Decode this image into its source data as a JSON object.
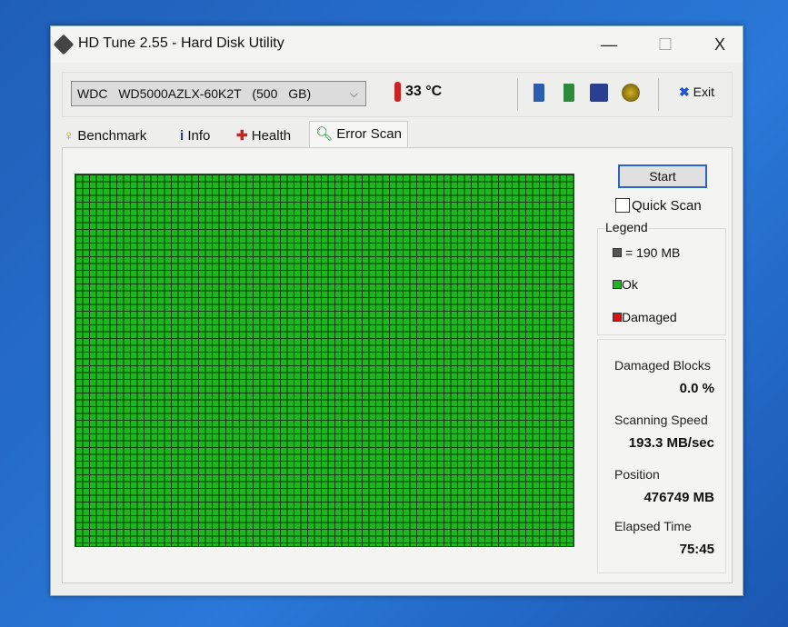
{
  "window": {
    "title": "HD Tune 2.55 - Hard Disk Utility",
    "minimize": "—",
    "maximize": "☐",
    "close": "X"
  },
  "toolbar": {
    "drive": "WDC WD5000AZLX-60K2T (500 GB)",
    "drive_chevron": "⌵",
    "temperature": "33 °C",
    "exit_label": "Exit"
  },
  "tabs": [
    {
      "label": "Benchmark"
    },
    {
      "label": "Info"
    },
    {
      "label": "Health"
    },
    {
      "label": "Error Scan"
    }
  ],
  "scan": {
    "start_label": "Start",
    "quick_scan_label": "Quick Scan",
    "quick_scan_checked": false,
    "legend_title": "Legend",
    "legend_block": "= 190 MB",
    "legend_ok": "Ok",
    "legend_damaged": "Damaged",
    "colors": {
      "ok": "#1eb51e",
      "damaged": "#dd1111",
      "block": "#555555"
    },
    "damaged_blocks_label": "Damaged Blocks",
    "damaged_blocks_value": "0.0 %",
    "scanning_speed_label": "Scanning Speed",
    "scanning_speed_value": "193.3 MB/sec",
    "position_label": "Position",
    "position_value": "476749 MB",
    "elapsed_label": "Elapsed Time",
    "elapsed_value": "75:45"
  }
}
